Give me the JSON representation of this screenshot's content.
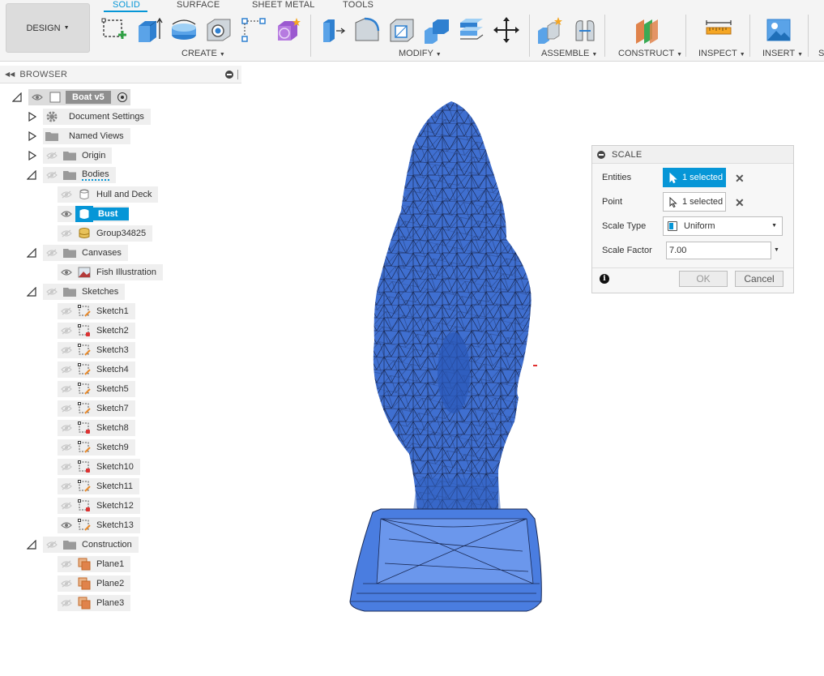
{
  "toolbar": {
    "design_label": "DESIGN",
    "tabs": [
      {
        "label": "SOLID",
        "active": true
      },
      {
        "label": "SURFACE",
        "active": false
      },
      {
        "label": "SHEET METAL",
        "active": false
      },
      {
        "label": "TOOLS",
        "active": false
      }
    ],
    "groups": {
      "create": "CREATE",
      "modify": "MODIFY",
      "assemble": "ASSEMBLE",
      "construct": "CONSTRUCT",
      "inspect": "INSPECT",
      "insert": "INSERT",
      "select_partial": "S"
    },
    "accent_color": "#0696d7"
  },
  "browser": {
    "title": "BROWSER",
    "root": "Boat v5",
    "items": {
      "document_settings": "Document Settings",
      "named_views": "Named Views",
      "origin": "Origin",
      "bodies": "Bodies",
      "hull_and_deck": "Hull and Deck",
      "bust": "Bust",
      "group": "Group34825",
      "canvases": "Canvases",
      "fish_illustration": "Fish Illustration",
      "sketches": "Sketches",
      "construction": "Construction"
    },
    "sketches": [
      "Sketch1",
      "Sketch2",
      "Sketch3",
      "Sketch4",
      "Sketch5",
      "Sketch7",
      "Sketch8",
      "Sketch9",
      "Sketch10",
      "Sketch11",
      "Sketch12",
      "Sketch13"
    ],
    "planes": [
      "Plane1",
      "Plane2",
      "Plane3"
    ]
  },
  "scale_dialog": {
    "title": "SCALE",
    "entities_label": "Entities",
    "entities_value": "1 selected",
    "point_label": "Point",
    "point_value": "1 selected",
    "scale_type_label": "Scale Type",
    "scale_type_value": "Uniform",
    "scale_factor_label": "Scale Factor",
    "scale_factor_value": "7.00",
    "ok_label": "OK",
    "cancel_label": "Cancel"
  }
}
